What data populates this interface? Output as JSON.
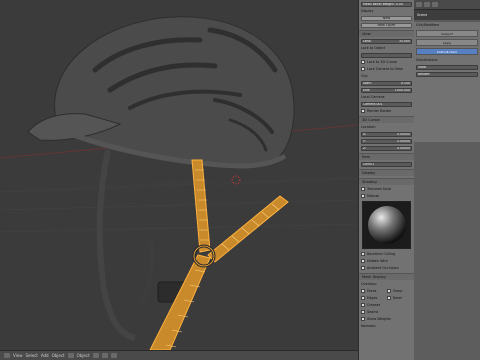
{
  "bottombar": {
    "mode_label": "Object",
    "view_label": "View",
    "select_label": "Select",
    "add_label": "Add",
    "object_label": "Object"
  },
  "properties": {
    "header_dropdown": "Mean Bevel Weight: 0.00",
    "section_display": "Display",
    "new_label": "New",
    "new_layer_label": "New Layer",
    "view_section": "View",
    "lens_label": "Lens:",
    "lens_value": "35.000",
    "lock_to_object": "Lock to Object",
    "lock_to_cursor": "Lock to 3D Cursor",
    "lock_camera": "Lock Camera to View",
    "clip_label": "Clip:",
    "clip_start_label": "Start:",
    "clip_start_value": "0.100",
    "clip_end_label": "End:",
    "clip_end_value": "1000.000",
    "local_camera": "Local Camera:",
    "camera_field": "Camera.001",
    "render_border": "Render Border",
    "cursor_section": "3D Cursor",
    "location_label": "Location:",
    "x_label": "X:",
    "x_value": "0.00000",
    "y_label": "Y:",
    "y_value": "0.00000",
    "z_label": "Z:",
    "z_value": "0.00000",
    "item_section": "Item",
    "item_name": "Chin01",
    "display_section": "Display",
    "shading_section": "Shading",
    "textured_solid": "Textured Solid",
    "matcap": "Matcap",
    "backface_culling": "Backface Culling",
    "hidden_wire": "Hidden Wire",
    "ambient_occlusion": "Ambient Occlusion",
    "mesh_display": "Mesh Display",
    "overlays_label": "Overlays:",
    "faces": "Faces",
    "sharp": "Sharp",
    "edges": "Edges",
    "bevel": "Bevel",
    "creases": "Creases",
    "seams": "Seams",
    "show_weights": "Show Weights",
    "normals_label": "Normals:"
  },
  "outliner": {
    "tree_item": "Scene",
    "uv_title": "UVs/Modifiers",
    "tab_one": "Subsurf",
    "tab_two": "Apply",
    "active_tab": "Catmull-Clark",
    "subdivisions_label": "Subdivisions:",
    "view_label": "View:",
    "render_label": "Render:"
  },
  "colors": {
    "accent": "#f5a623",
    "wire": "#ffb13d",
    "helmet": "#4b4b4b",
    "active_tab": "#5680c2"
  }
}
